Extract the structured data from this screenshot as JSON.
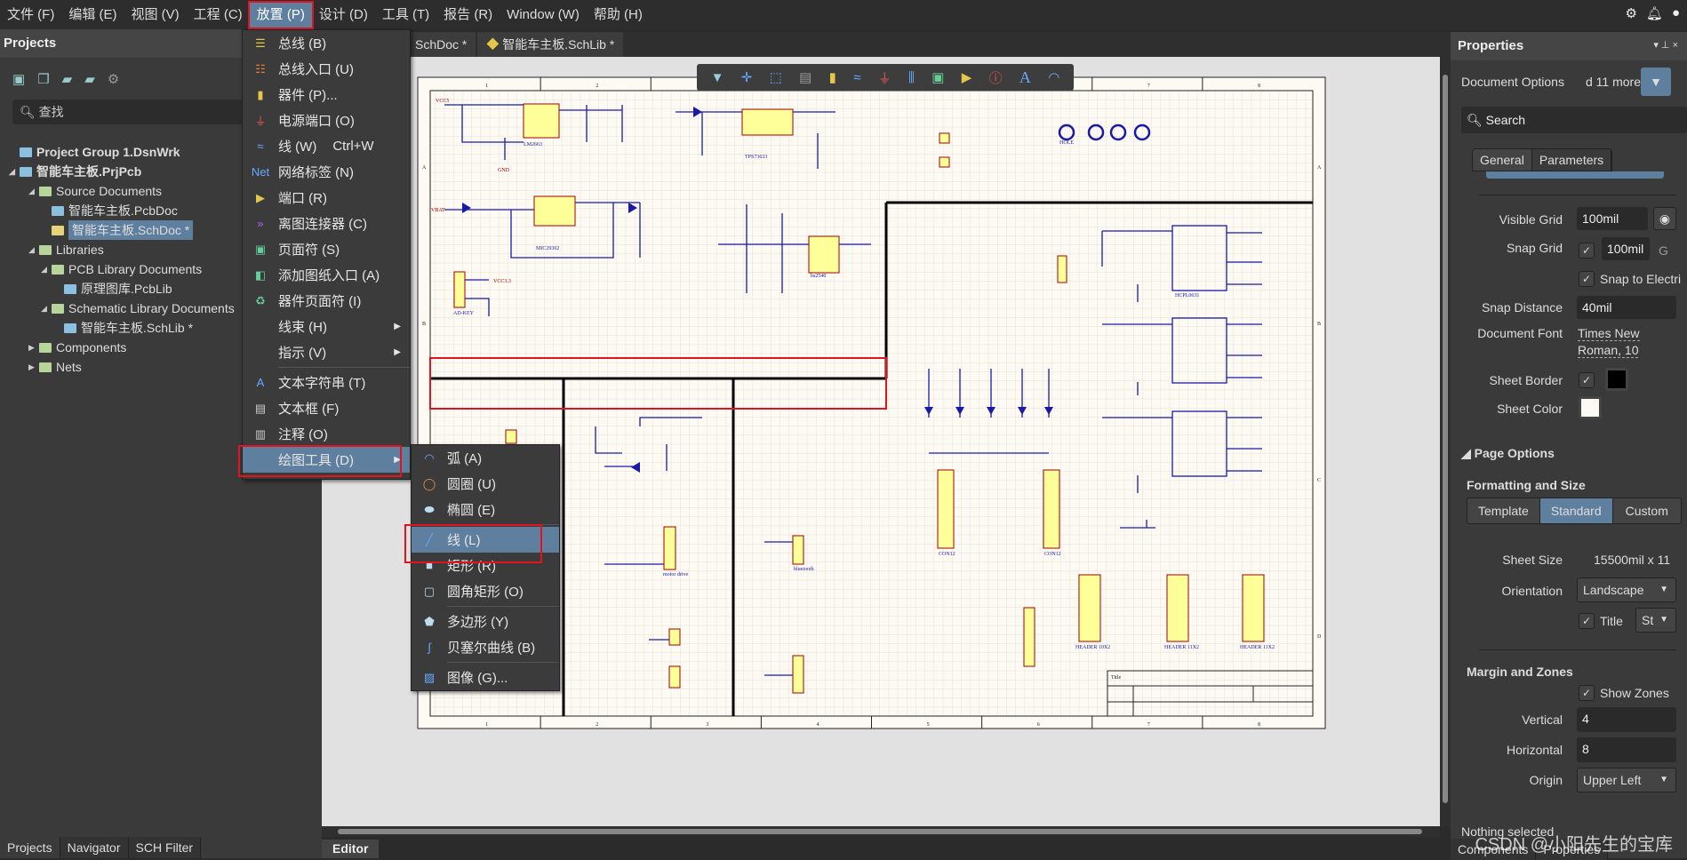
{
  "menubar": {
    "items": [
      "文件 (F)",
      "编辑 (E)",
      "视图 (V)",
      "工程 (C)",
      "放置 (P)",
      "设计 (D)",
      "工具 (T)",
      "报告 (R)",
      "Window (W)",
      "帮助 (H)"
    ],
    "active_index": 4
  },
  "top_icons": [
    "gear-icon",
    "bell-icon",
    "user-icon"
  ],
  "projects": {
    "title": "Projects",
    "search_placeholder": "查找",
    "tree": [
      {
        "label": "Project Group 1.DsnWrk",
        "level": 0,
        "bold": true
      },
      {
        "label": "智能车主板.PrjPcb",
        "level": 0,
        "bold": true,
        "expanded": true
      },
      {
        "label": "Source Documents",
        "level": 1,
        "folder": true,
        "expanded": true
      },
      {
        "label": "智能车主板.PcbDoc",
        "level": 2
      },
      {
        "label": "智能车主板.SchDoc *",
        "level": 2,
        "selected": true
      },
      {
        "label": "Libraries",
        "level": 1,
        "folder": true,
        "expanded": true
      },
      {
        "label": "PCB Library Documents",
        "level": 2,
        "folder": true,
        "expanded": true
      },
      {
        "label": "原理图库.PcbLib",
        "level": 3
      },
      {
        "label": "Schematic Library Documents",
        "level": 2,
        "folder": true,
        "expanded": true
      },
      {
        "label": "智能车主板.SchLib *",
        "level": 3
      },
      {
        "label": "Components",
        "level": 1,
        "folder": true
      },
      {
        "label": "Nets",
        "level": 1,
        "folder": true
      }
    ],
    "bottom_tabs": [
      "Projects",
      "Navigator",
      "SCH Filter"
    ]
  },
  "doc_tabs": [
    "SchDoc *",
    "智能车主板.SchLib *"
  ],
  "editor_tab": "Editor",
  "place_menu": [
    {
      "label": "总线 (B)",
      "icon": "bus-icon"
    },
    {
      "label": "总线入口 (U)",
      "icon": "bus-entry-icon"
    },
    {
      "label": "器件 (P)...",
      "icon": "part-icon"
    },
    {
      "label": "电源端口 (O)",
      "icon": "power-port-icon"
    },
    {
      "label": "线 (W)",
      "shortcut": "Ctrl+W",
      "icon": "wire-icon"
    },
    {
      "label": "网络标签 (N)",
      "icon": "net-label-icon"
    },
    {
      "label": "端口 (R)",
      "icon": "port-icon"
    },
    {
      "label": "离图连接器 (C)",
      "icon": "off-sheet-connector-icon"
    },
    {
      "label": "页面符 (S)",
      "icon": "sheet-symbol-icon"
    },
    {
      "label": "添加图纸入口 (A)",
      "icon": "sheet-entry-icon"
    },
    {
      "label": "器件页面符 (I)",
      "icon": "device-sheet-icon"
    },
    {
      "label": "线束 (H)",
      "submenu": true
    },
    {
      "label": "指示 (V)",
      "submenu": true
    },
    {
      "label": "文本字符串 (T)",
      "icon": "text-icon"
    },
    {
      "label": "文本框 (F)",
      "icon": "text-frame-icon"
    },
    {
      "label": "注释 (O)",
      "icon": "note-icon"
    },
    {
      "label": "绘图工具 (D)",
      "submenu": true,
      "highlighted": true
    }
  ],
  "drawing_tools_menu": [
    {
      "label": "弧 (A)",
      "icon": "arc-icon"
    },
    {
      "label": "圆圈 (U)",
      "icon": "circle-icon"
    },
    {
      "label": "椭圆 (E)",
      "icon": "ellipse-icon"
    },
    {
      "label": "线 (L)",
      "icon": "line-icon",
      "highlighted": true
    },
    {
      "label": "矩形 (R)",
      "icon": "rectangle-icon"
    },
    {
      "label": "圆角矩形 (O)",
      "icon": "round-rectangle-icon"
    },
    {
      "label": "多边形 (Y)",
      "icon": "polygon-icon"
    },
    {
      "label": "贝塞尔曲线 (B)",
      "icon": "bezier-icon"
    },
    {
      "label": "图像 (G)...",
      "icon": "image-icon"
    }
  ],
  "floating_toolbar": [
    "filter-icon",
    "move-icon",
    "select-icon",
    "align-icon",
    "part-icon",
    "wire-icon",
    "power-icon",
    "bus-icon",
    "sheet-symbol-icon",
    "port-icon",
    "directive-icon",
    "text-icon",
    "arc-icon"
  ],
  "schematic": {
    "zones_x": [
      "1",
      "2",
      "3",
      "4",
      "5",
      "6",
      "7",
      "8"
    ],
    "zones_y": [
      "A",
      "B",
      "C",
      "D"
    ],
    "labels": {
      "u2": "LM2663",
      "u4": "MIC29302",
      "u1": "TPS73633",
      "u5": "bs2540",
      "j1": "AD-KEY",
      "gnd": "GND",
      "vcc5": "VCC5",
      "vbat": "VBAT",
      "vcc33": "VCC3.3",
      "hole": "HOLE",
      "opto": "HCPL0631",
      "conn1": "CON12",
      "conn2": "CON12",
      "hdr1": "HEADER 10X2",
      "hdr2": "HEADER 11X2",
      "hdr3": "HEADER 11X2",
      "bluetooth": "bluetooth",
      "motor": "motor drive",
      "title": "Title"
    }
  },
  "properties": {
    "title": "Properties",
    "doc_options": "Document Options",
    "doc_more": "d 11 more)",
    "search_placeholder": "Search",
    "tabs": [
      "General",
      "Parameters"
    ],
    "visible_grid_label": "Visible Grid",
    "visible_grid": "100mil",
    "snap_grid_label": "Snap Grid",
    "snap_grid": "100mil",
    "snap_grid_key": "G",
    "snap_grid_checked": true,
    "snap_electrical": "Snap to Electri",
    "snap_electrical_checked": true,
    "snap_distance_label": "Snap Distance",
    "snap_distance": "40mil",
    "doc_font_label": "Document Font",
    "doc_font_line1": "Times New",
    "doc_font_line2": "Roman, 10",
    "sheet_border_label": "Sheet Border",
    "sheet_border_checked": true,
    "sheet_border_color": "#000000",
    "sheet_color_label": "Sheet Color",
    "sheet_color": "#fdfaf3",
    "page_options": "Page Options",
    "formatting": "Formatting and Size",
    "format_modes": [
      "Template",
      "Standard",
      "Custom"
    ],
    "format_active": "Standard",
    "sheet_size_label": "Sheet Size",
    "sheet_size": "15500mil x 11",
    "orientation_label": "Orientation",
    "orientation": "Landscape",
    "title_label": "Title",
    "title_checked": true,
    "title_style": "St",
    "margin": "Margin and Zones",
    "show_zones": "Show Zones",
    "show_zones_checked": true,
    "vertical_label": "Vertical",
    "vertical": "4",
    "horizontal_label": "Horizontal",
    "horizontal": "8",
    "origin_label": "Origin",
    "origin": "Upper Left",
    "status": "Nothing selected",
    "bottom_tabs": [
      "Components",
      "Properties"
    ]
  },
  "watermark": "CSDN @小阳先生的宝库",
  "colors": {
    "accent": "#5f7f9f",
    "highlight_box": "#e0141e",
    "wire": "#1a1aa6",
    "component_fill": "#ffff99",
    "component_border": "#a00000"
  }
}
